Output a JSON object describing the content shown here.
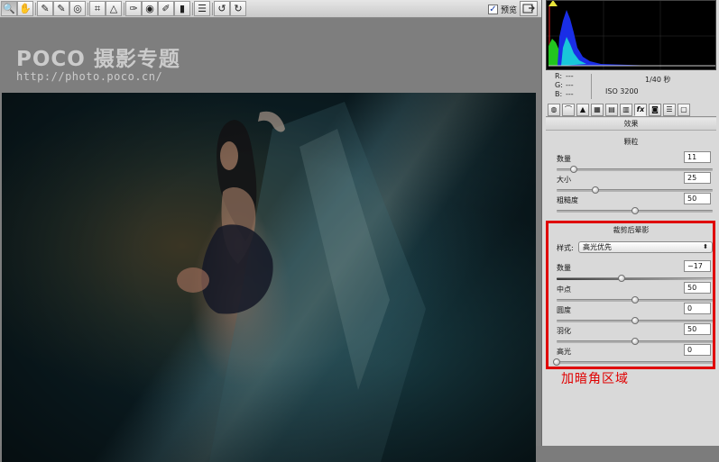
{
  "toolbar": {
    "tools": [
      {
        "icon": "zoom-icon",
        "glyph": "🔍"
      },
      {
        "icon": "hand-icon",
        "glyph": "✋"
      },
      {
        "icon": "white-balance-icon",
        "glyph": "✎"
      },
      {
        "icon": "color-sampler-icon",
        "glyph": "✎"
      },
      {
        "icon": "target-adjust-icon",
        "glyph": "◎"
      },
      {
        "icon": "crop-icon",
        "glyph": "⌗"
      },
      {
        "icon": "straighten-icon",
        "glyph": "△"
      },
      {
        "icon": "spot-removal-icon",
        "glyph": "✑"
      },
      {
        "icon": "red-eye-icon",
        "glyph": "◉"
      },
      {
        "icon": "adjustment-brush-icon",
        "glyph": "✐"
      },
      {
        "icon": "graduated-filter-icon",
        "glyph": "▮"
      },
      {
        "icon": "preferences-icon",
        "glyph": "☰"
      },
      {
        "icon": "rotate-left-icon",
        "glyph": "↺"
      },
      {
        "icon": "rotate-right-icon",
        "glyph": "↻"
      }
    ],
    "preview_checked": true,
    "preview_label": "预览",
    "fullscreen_icon": "fullscreen-icon"
  },
  "watermark": {
    "brand": "POCO 摄影专题",
    "url": "http://photo.poco.cn/"
  },
  "readout": {
    "r_label": "R:",
    "r_value": "---",
    "g_label": "G:",
    "g_value": "---",
    "b_label": "B:",
    "b_value": "---",
    "shutter": "1/40 秒",
    "iso": "ISO 3200"
  },
  "tabs": [
    {
      "icon": "basic-tab-icon",
      "glyph": "◍"
    },
    {
      "icon": "tone-curve-tab-icon",
      "glyph": "⌒"
    },
    {
      "icon": "detail-tab-icon",
      "glyph": "▲"
    },
    {
      "icon": "hsl-tab-icon",
      "glyph": "▦"
    },
    {
      "icon": "split-toning-tab-icon",
      "glyph": "▤"
    },
    {
      "icon": "lens-corrections-tab-icon",
      "glyph": "▥"
    },
    {
      "icon": "effects-tab-icon",
      "glyph": "fx"
    },
    {
      "icon": "camera-calibration-tab-icon",
      "glyph": "◙"
    },
    {
      "icon": "presets-tab-icon",
      "glyph": "☰"
    },
    {
      "icon": "snapshots-tab-icon",
      "glyph": "▢"
    }
  ],
  "panel": {
    "title": "效果",
    "grain": {
      "title": "颗粒",
      "sliders": [
        {
          "label": "数量",
          "value": "11",
          "fraction": 0.11
        },
        {
          "label": "大小",
          "value": "25",
          "fraction": 0.25
        },
        {
          "label": "粗糙度",
          "value": "50",
          "fraction": 0.5
        }
      ]
    },
    "vignette": {
      "title": "裁剪后晕影",
      "style_label": "样式:",
      "style_value": "高光优先",
      "sliders": [
        {
          "label": "数量",
          "value": "−17",
          "fraction": 0.415
        },
        {
          "label": "中点",
          "value": "50",
          "fraction": 0.5
        },
        {
          "label": "圆度",
          "value": "0",
          "fraction": 0.5
        },
        {
          "label": "羽化",
          "value": "50",
          "fraction": 0.5
        },
        {
          "label": "高光",
          "value": "0",
          "fraction": 0.0
        }
      ]
    }
  },
  "annotation": "加暗角区域",
  "colors": {
    "annotation": "#e00000",
    "panel_bg": "#d9d9d9",
    "canvas_bg": "#7e7e7e"
  }
}
